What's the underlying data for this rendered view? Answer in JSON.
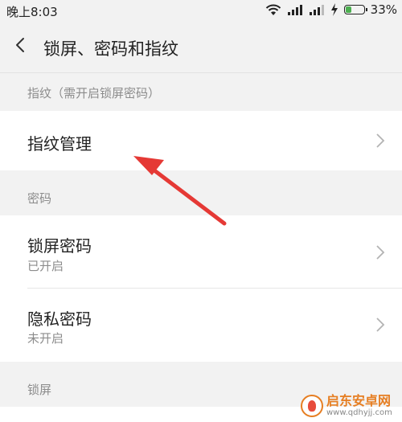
{
  "status_bar": {
    "time": "晚上8:03",
    "battery_percent": "33%",
    "battery_level": 0.33
  },
  "header": {
    "title": "锁屏、密码和指纹"
  },
  "sections": {
    "fingerprint_label": "指纹（需开启锁屏密码）",
    "fingerprint_manage": "指纹管理",
    "password_label": "密码",
    "lock_password": {
      "title": "锁屏密码",
      "status": "已开启"
    },
    "privacy_password": {
      "title": "隐私密码",
      "status": "未开启"
    },
    "lockscreen_label": "锁屏"
  },
  "watermark": {
    "name": "启东安卓网",
    "url": "www.qdhyjj.com"
  },
  "colors": {
    "arrow": "#e53935",
    "panel": "#ffffff",
    "background": "#f2f2f2",
    "battery": "#4caf50"
  }
}
